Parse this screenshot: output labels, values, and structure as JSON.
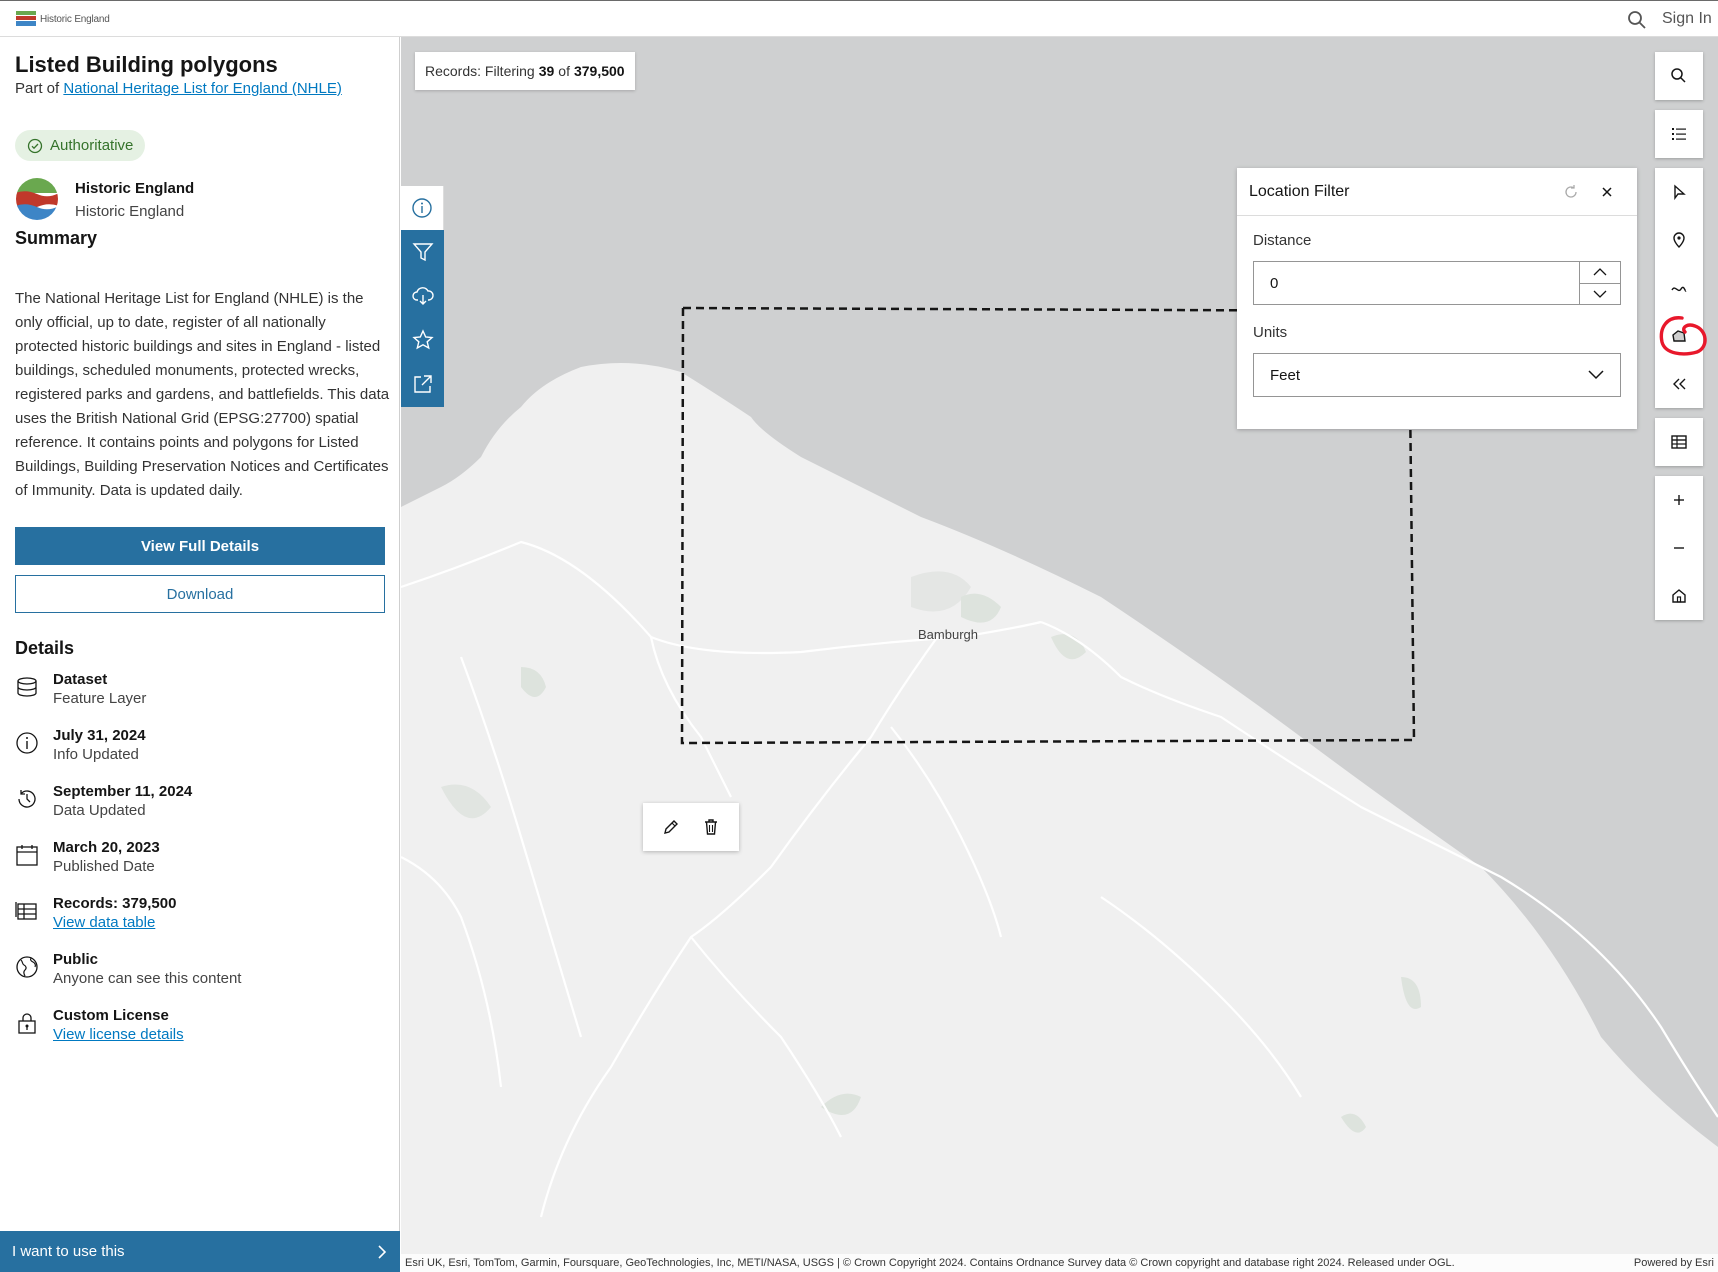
{
  "topbar": {
    "logo_text": "Historic England",
    "sign_in": "Sign In"
  },
  "sidebar": {
    "title": "Listed Building polygons",
    "part_of_prefix": "Part of",
    "part_of_link": "National Heritage List for England (NHLE)",
    "badge": "Authoritative",
    "org": {
      "name": "Historic England",
      "owner": "Historic England"
    },
    "summary_heading": "Summary",
    "summary_text": "The National Heritage List for England (NHLE) is the only official, up to date, register of all nationally protected historic buildings and sites in England - listed buildings, scheduled monuments, protected wrecks, registered parks and gardens, and battlefields. This data uses the British National Grid (EPSG:27700) spatial reference. It contains points and polygons for Listed Buildings, Building Preservation Notices and Certificates of Immunity. Data is updated daily.",
    "view_full_details": "View Full Details",
    "download": "Download",
    "details_heading": "Details",
    "details": [
      {
        "main": "Dataset",
        "sub": "Feature Layer",
        "icon": "database-icon"
      },
      {
        "main": "July 31, 2024",
        "sub": "Info Updated",
        "icon": "info-icon"
      },
      {
        "main": "September 11, 2024",
        "sub": "Data Updated",
        "icon": "history-icon"
      },
      {
        "main": "March 20, 2023",
        "sub": "Published Date",
        "icon": "calendar-icon"
      },
      {
        "main": "Records: 379,500",
        "sub": "View data table",
        "icon": "table-icon"
      },
      {
        "main": "Public",
        "sub": "Anyone can see this content",
        "icon": "globe-icon"
      },
      {
        "main": "Custom License",
        "sub": "View license details",
        "icon": "lock-icon"
      }
    ],
    "use_bar": "I want to use this"
  },
  "map": {
    "records_prefix": "Records: Filtering",
    "records_filtered": "39",
    "records_of": "of",
    "records_total": "379,500",
    "place_label": "Bamburgh",
    "attribution": "Esri UK, Esri, TomTom, Garmin, Foursquare, GeoTechnologies, Inc, METI/NASA, USGS | © Crown Copyright 2024. Contains Ordnance Survey data © Crown copyright and database right 2024. Released under OGL.",
    "powered_by": "Powered by Esri"
  },
  "location_filter": {
    "title": "Location Filter",
    "distance_label": "Distance",
    "distance_value": "0",
    "units_label": "Units",
    "units_value": "Feet"
  },
  "colors": {
    "accent": "#2770a0",
    "link": "#0079c1",
    "badge_bg": "#e5f1e3",
    "badge_text": "#35732b",
    "water": "#cfd0d1",
    "land": "#f0f0f0"
  }
}
